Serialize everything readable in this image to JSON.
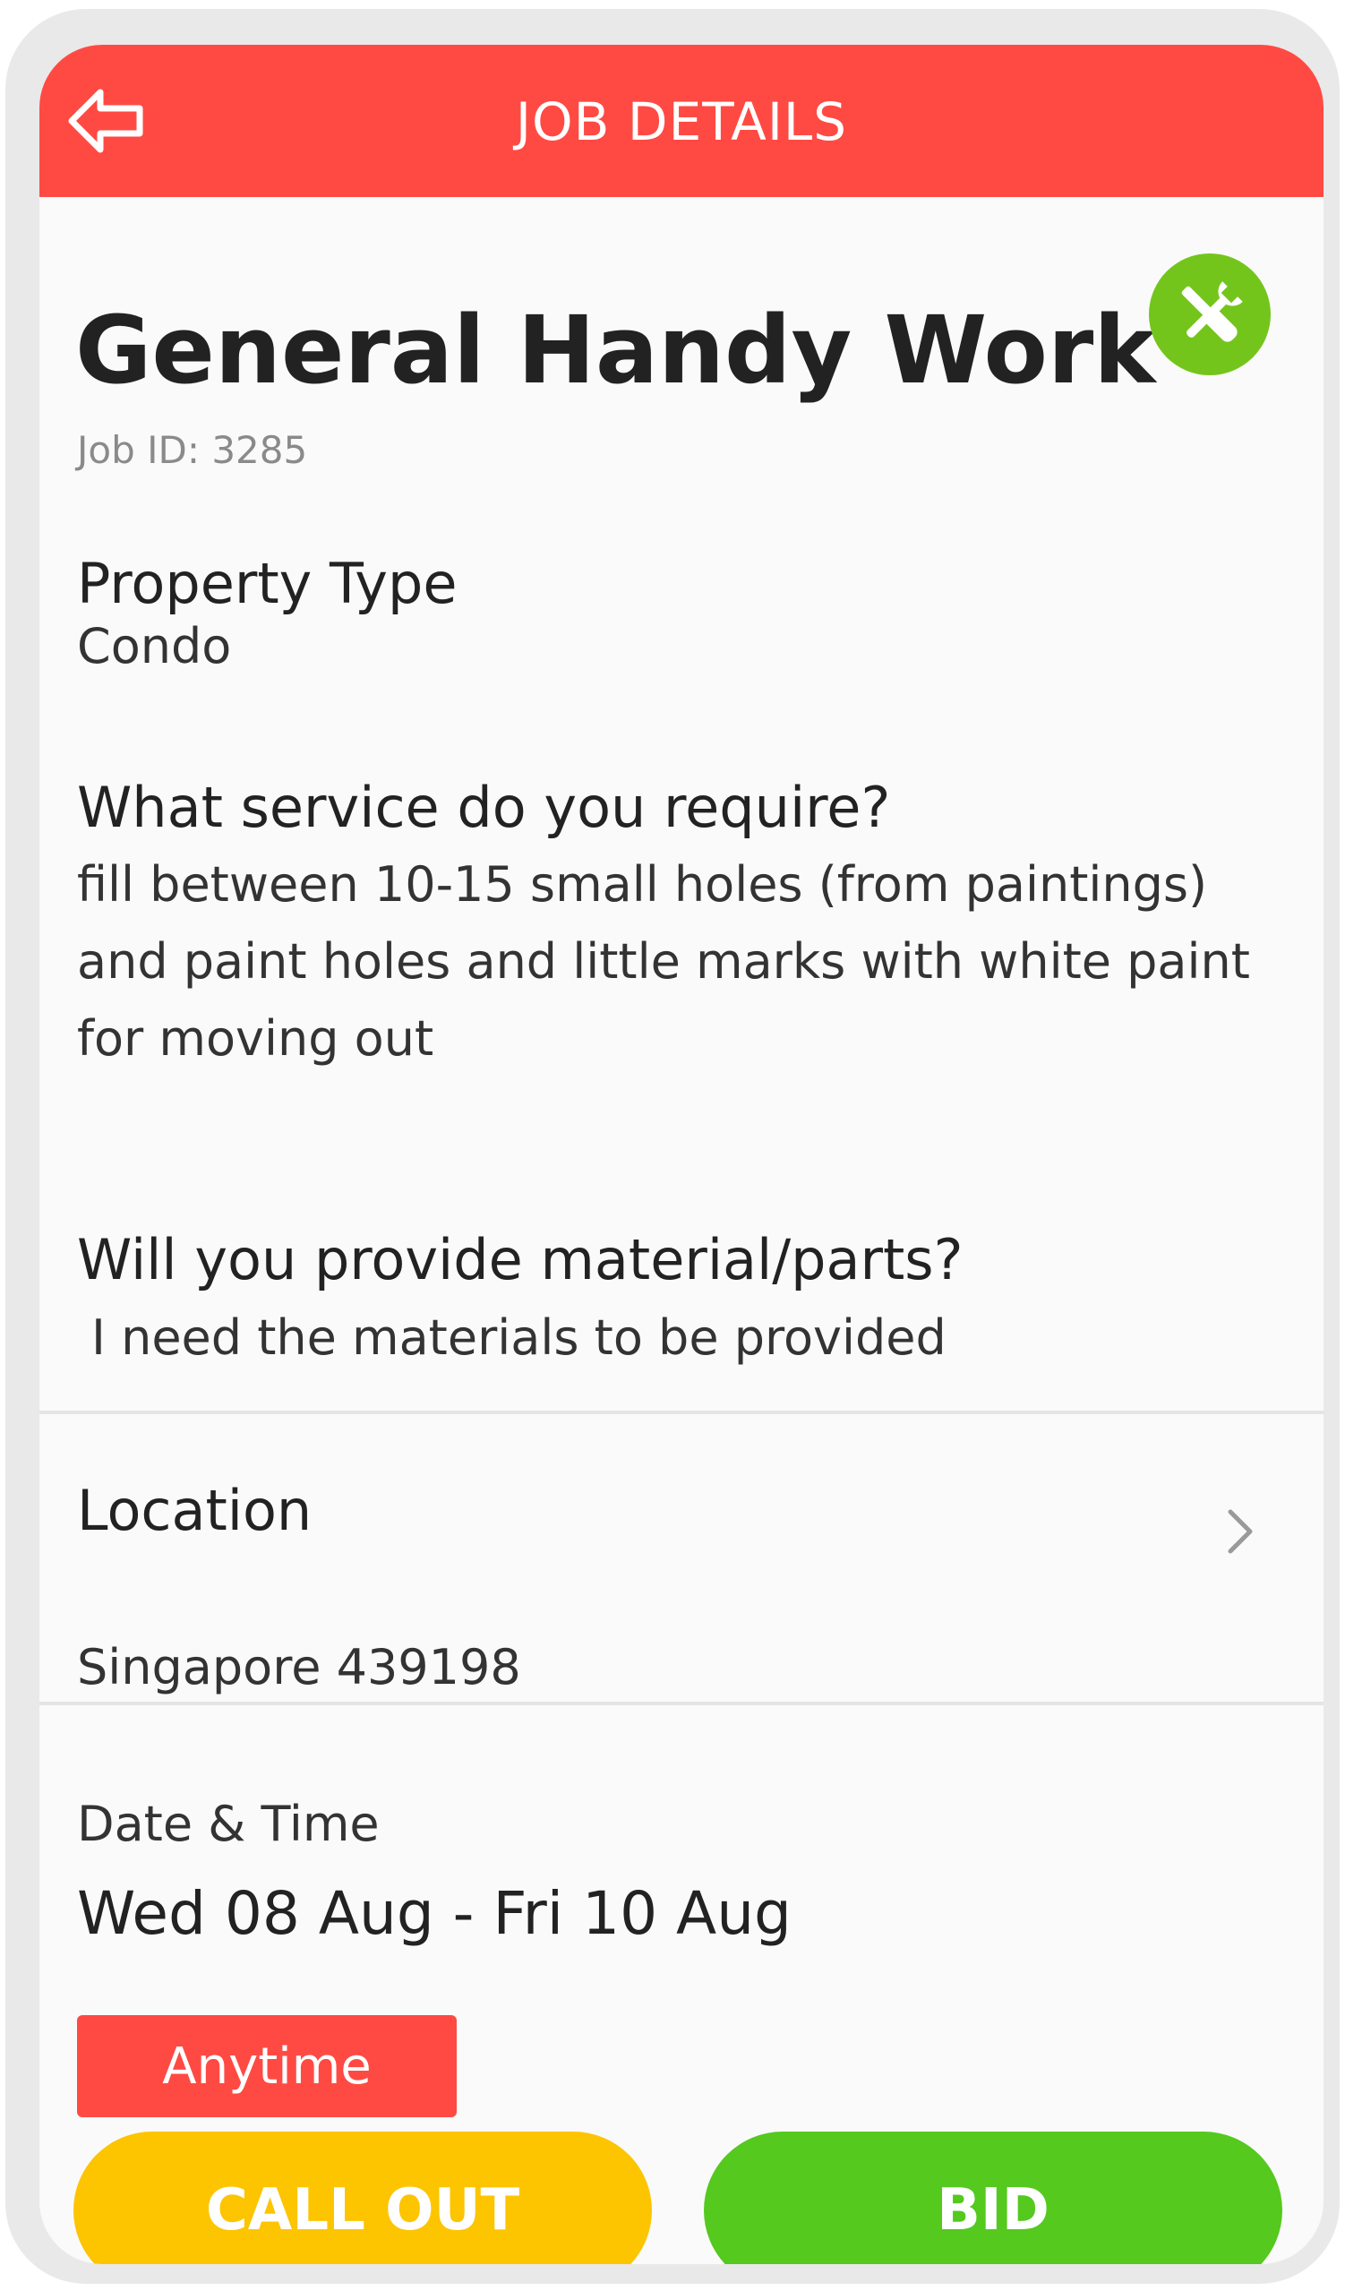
{
  "header": {
    "title": "JOB DETAILS",
    "back_icon": "back-arrow-icon",
    "color": "#ff4a43"
  },
  "job": {
    "title": "General Handy Work",
    "id_label": "Job ID: 3285",
    "category_icon": "tools-icon",
    "category_color": "#74c51b"
  },
  "property": {
    "label": "Property Type",
    "value": "Condo"
  },
  "service": {
    "label": "What service do you require?",
    "value": "fill between 10-15 small holes (from paintings) and paint holes and little marks with white paint for moving out"
  },
  "materials": {
    "label": "Will you provide material/parts?",
    "value": "I need the materials to be provided"
  },
  "location": {
    "label": "Location",
    "value": "Singapore 439198",
    "chevron_icon": "chevron-right-icon"
  },
  "datetime": {
    "label": "Date & Time",
    "value": "Wed 08 Aug - Fri 10 Aug",
    "time_badge": "Anytime"
  },
  "actions": {
    "call_out": "CALL OUT",
    "bid": "BID",
    "call_color": "#fdc400",
    "bid_color": "#55c91e"
  }
}
